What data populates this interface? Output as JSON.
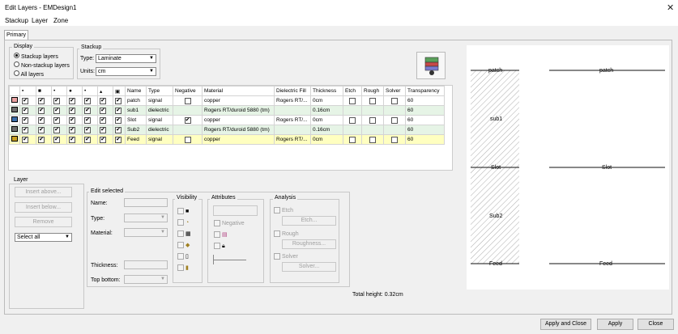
{
  "window": {
    "title": "Edit Layers - EMDesign1",
    "close_glyph": "✕"
  },
  "menu": [
    "Stackup",
    "Layer",
    "Zone"
  ],
  "tab": "Primary",
  "display": {
    "label": "Display",
    "options": [
      "Stackup layers",
      "Non-stackup layers",
      "All layers"
    ],
    "selected": "Stackup layers"
  },
  "stackup": {
    "label": "Stackup",
    "type_label": "Type:",
    "type_value": "Laminate",
    "units_label": "Units:",
    "units_value": "cm"
  },
  "table": {
    "icon_headers": [
      "lock-icon",
      "square-icon",
      "dot-icon",
      "filled-dot-icon",
      "dot-icon",
      "pin-icon",
      "grid-icon"
    ],
    "headers": [
      "Name",
      "Type",
      "Negative",
      "Material",
      "Dielectric Fill",
      "Thickness",
      "Etch",
      "Rough",
      "Solver",
      "Transparency"
    ],
    "rows": [
      {
        "name": "patch",
        "type": "signal",
        "material": "copper",
        "fill": "Rogers RT/...",
        "thickness": "0cm",
        "transparency": "60",
        "color": "#e8a0a0",
        "bg": "#ffffff",
        "negative": false
      },
      {
        "name": "sub1",
        "type": "dielectric",
        "material": "Rogers RT/duroid 5880 (tm)",
        "fill": "",
        "thickness": "0.16cm",
        "transparency": "60",
        "color": "#6e6e6e",
        "bg": "#e6f4e6",
        "negative": false
      },
      {
        "name": "Slot",
        "type": "signal",
        "material": "copper",
        "fill": "Rogers RT/...",
        "thickness": "0cm",
        "transparency": "60",
        "color": "#3a6ea8",
        "bg": "#ffffff",
        "negative": true
      },
      {
        "name": "Sub2",
        "type": "dielectric",
        "material": "Rogers RT/duroid 5880 (tm)",
        "fill": "",
        "thickness": "0.16cm",
        "transparency": "60",
        "color": "#6e6e6e",
        "bg": "#e6f4e6",
        "negative": false
      },
      {
        "name": "Feed",
        "type": "signal",
        "material": "copper",
        "fill": "Rogers RT/...",
        "thickness": "0cm",
        "transparency": "60",
        "color": "#c8a020",
        "bg": "#ffffc0",
        "negative": false
      }
    ]
  },
  "layer_group": {
    "label": "Layer",
    "insert_above": "Insert above...",
    "insert_below": "Insert below...",
    "remove": "Remove",
    "select_all": "Select all"
  },
  "edit_selected": {
    "label": "Edit selected",
    "name_label": "Name:",
    "type_label": "Type:",
    "material_label": "Material:",
    "thickness_label": "Thickness:",
    "top_bottom_label": "Top bottom:",
    "visibility_label": "Visibility",
    "attributes_label": "Attributes",
    "negative_label": "Negative",
    "analysis_label": "Analysis",
    "etch_label": "Etch",
    "etch_button": "Etch...",
    "rough_label": "Rough",
    "roughness_button": "Roughness...",
    "solver_label": "Solver",
    "solver_button": "Solver..."
  },
  "total_height": "Total height: 0.32cm",
  "preview": {
    "labels_left": [
      "patch",
      "sub1",
      "Slot",
      "Sub2",
      "Feed"
    ],
    "labels_right": [
      "patch",
      "Slot",
      "Feed"
    ]
  },
  "buttons": {
    "apply_close": "Apply and Close",
    "apply": "Apply",
    "close": "Close"
  }
}
